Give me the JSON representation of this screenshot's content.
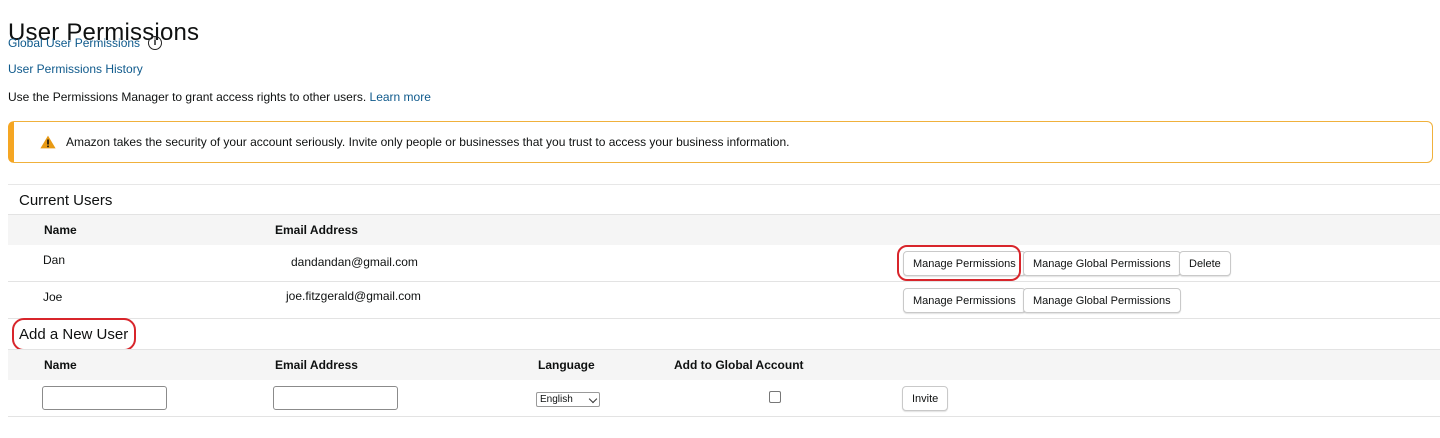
{
  "page": {
    "title": "User Permissions",
    "global_link": "Global User Permissions",
    "history_link": "User Permissions History",
    "intro_text": "Use the Permissions Manager to grant access rights to other users.",
    "learn_more": "Learn more"
  },
  "alert": {
    "icon": "warning-icon",
    "text": "Amazon takes the security of your account seriously. Invite only people or businesses that you trust to access your business information."
  },
  "current_users": {
    "title": "Current Users",
    "columns": [
      "Name",
      "Email Address"
    ],
    "rows": [
      {
        "name": "Dan",
        "email": "dandandan@gmail.com",
        "btn_manage": "Manage Permissions",
        "btn_global": "Manage Global Permissions",
        "btn_delete": "Delete"
      },
      {
        "name": "Joe",
        "email": "joe.fitzgerald@gmail.com",
        "btn_manage": "Manage Permissions",
        "btn_global": "Manage Global Permissions"
      }
    ]
  },
  "add_user": {
    "title": "Add a New User",
    "columns": [
      "Name",
      "Email Address",
      "Language",
      "Add to Global Account"
    ],
    "language_selected": "English",
    "invite_label": "Invite"
  },
  "colors": {
    "link": "#0f5a8c",
    "alert_border": "#f0b13c",
    "highlight": "#d8252b"
  }
}
